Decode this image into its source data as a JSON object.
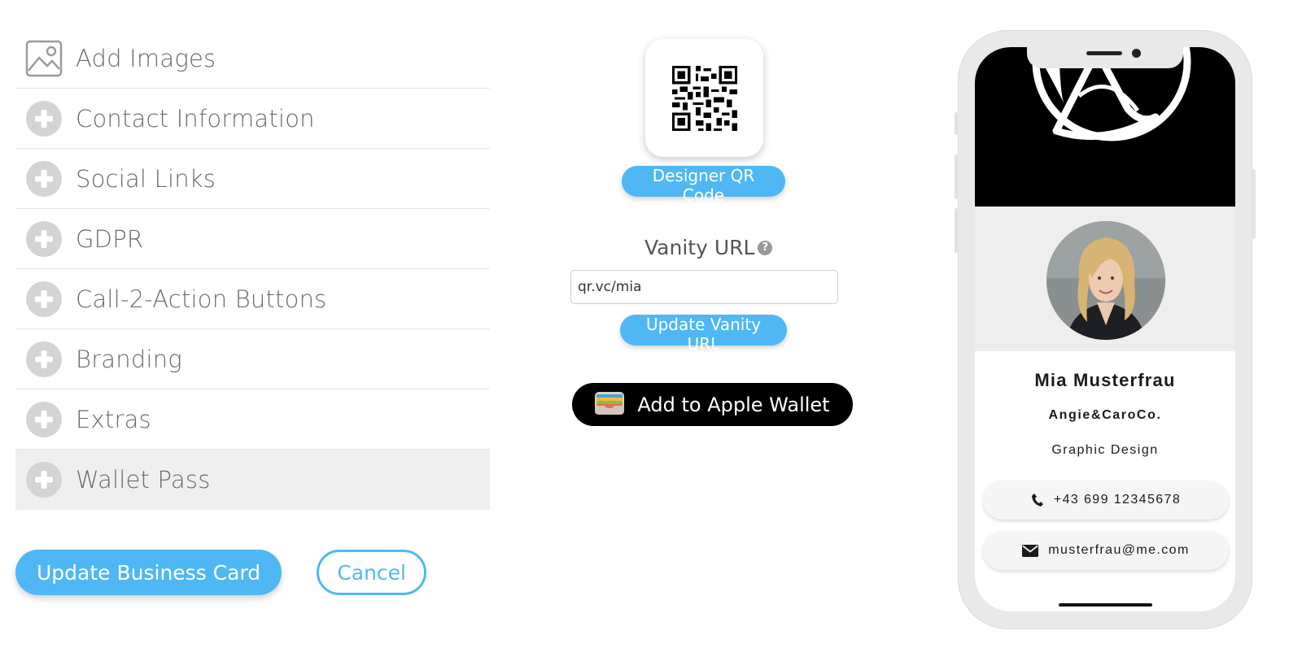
{
  "menu": {
    "items": [
      {
        "label": "Add Images",
        "icon": "image-icon"
      },
      {
        "label": "Contact Information",
        "icon": "plus-circle-icon"
      },
      {
        "label": "Social Links",
        "icon": "plus-circle-icon"
      },
      {
        "label": "GDPR",
        "icon": "plus-circle-icon"
      },
      {
        "label": "Call-2-Action Buttons",
        "icon": "plus-circle-icon"
      },
      {
        "label": "Branding",
        "icon": "plus-circle-icon"
      },
      {
        "label": "Extras",
        "icon": "plus-circle-icon"
      },
      {
        "label": "Wallet Pass",
        "icon": "plus-circle-icon",
        "active": true
      }
    ]
  },
  "actions": {
    "update_label": "Update Business Card",
    "cancel_label": "Cancel"
  },
  "qr": {
    "designer_label": "Designer QR Code"
  },
  "vanity": {
    "label": "Vanity URL",
    "help_glyph": "?",
    "value": "qr.vc/mia",
    "update_label": "Update Vanity URL"
  },
  "wallet": {
    "label": "Add to Apple Wallet"
  },
  "preview": {
    "name": "Mia Musterfrau",
    "company": "Angie&CaroCo.",
    "title": "Graphic Design",
    "phone": "+43 699 12345678",
    "email": "musterfrau@me.com"
  },
  "colors": {
    "accent": "#4fb8f4",
    "wallet_button": "#000000",
    "active_row": "#efefef",
    "phone_frame": "#e9e9e9"
  }
}
